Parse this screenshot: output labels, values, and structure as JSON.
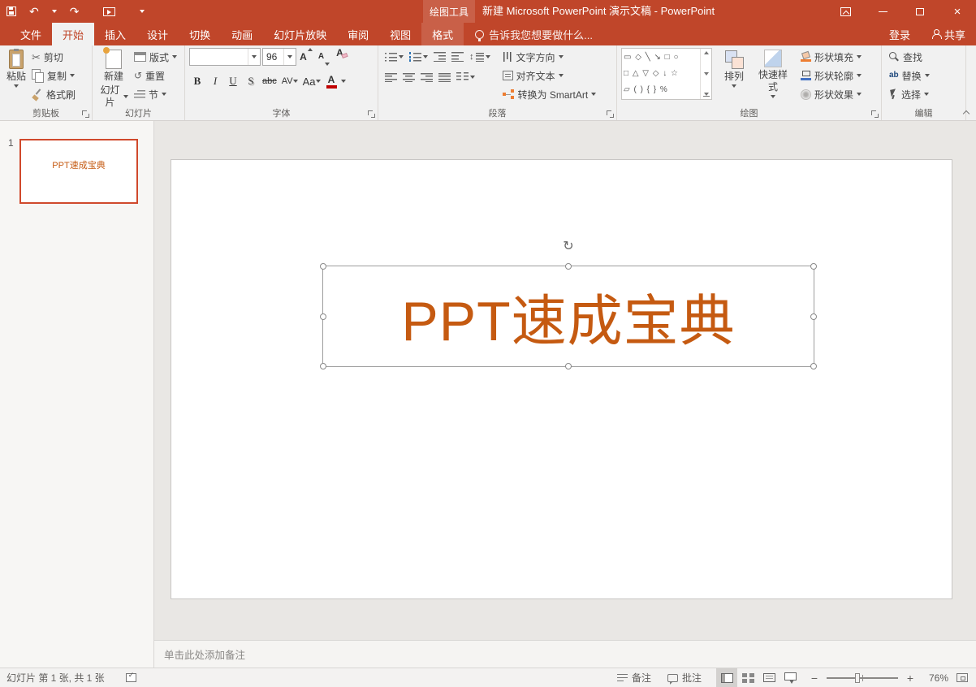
{
  "titlebar": {
    "context_group": "绘图工具",
    "title": "新建 Microsoft PowerPoint 演示文稿 - PowerPoint"
  },
  "tabs": {
    "file": "文件",
    "main": [
      "开始",
      "插入",
      "设计",
      "切换",
      "动画",
      "幻灯片放映",
      "审阅",
      "视图"
    ],
    "contextual": "格式",
    "tell_me": "告诉我您想要做什么...",
    "sign_in": "登录",
    "share": "共享"
  },
  "ribbon": {
    "clipboard": {
      "label": "剪贴板",
      "paste": "粘贴",
      "cut": "剪切",
      "copy": "复制",
      "format_painter": "格式刷"
    },
    "slides": {
      "label": "幻灯片",
      "new_slide_line1": "新建",
      "new_slide_line2": "幻灯片",
      "layout": "版式",
      "reset": "重置",
      "section": "节"
    },
    "font": {
      "label": "字体",
      "name_value": "",
      "size_value": "96",
      "bold": "B",
      "italic": "I",
      "underline": "U",
      "shadow": "S",
      "strike": "abc",
      "spacing": "AV",
      "case_btn": "Aa",
      "color_btn": "A"
    },
    "paragraph": {
      "label": "段落",
      "text_direction": "文字方向",
      "align_text": "对齐文本",
      "smartart": "转换为 SmartArt"
    },
    "drawing": {
      "label": "绘图",
      "arrange": "排列",
      "quick_styles": "快速样式",
      "fill": "形状填充",
      "outline": "形状轮廓",
      "effects": "形状效果",
      "shapes_row1": "▭ ◇ ╲ ↘ □ ○",
      "shapes_row2": "□ △ ▽ ◇ ↓ ☆",
      "shapes_row3": "▱ ( ) { } %"
    },
    "editing": {
      "label": "编辑",
      "find": "查找",
      "replace": "替换",
      "select": "选择"
    }
  },
  "thumbnail_panel": {
    "slide_number": "1",
    "slide_text": "PPT速成宝典"
  },
  "slide": {
    "title_text": "PPT速成宝典"
  },
  "notes": {
    "placeholder": "单击此处添加备注"
  },
  "statusbar": {
    "slide_info": "幻灯片 第 1 张, 共 1 张",
    "notes_button": "备注",
    "comments_button": "批注",
    "zoom_level": "76%"
  },
  "glyphs": {
    "undo": "↶",
    "redo": "↷",
    "cut": "✂",
    "reset": "↺",
    "rotate": "↻",
    "close": "×",
    "minus": "−",
    "plus": "+",
    "updown": "↕",
    "check": "✓"
  },
  "colors": {
    "brand": "#C0462A",
    "slide_text": "#C55A11",
    "selection_border": "#9E9E9E",
    "font_color_bar": "#C00000"
  }
}
